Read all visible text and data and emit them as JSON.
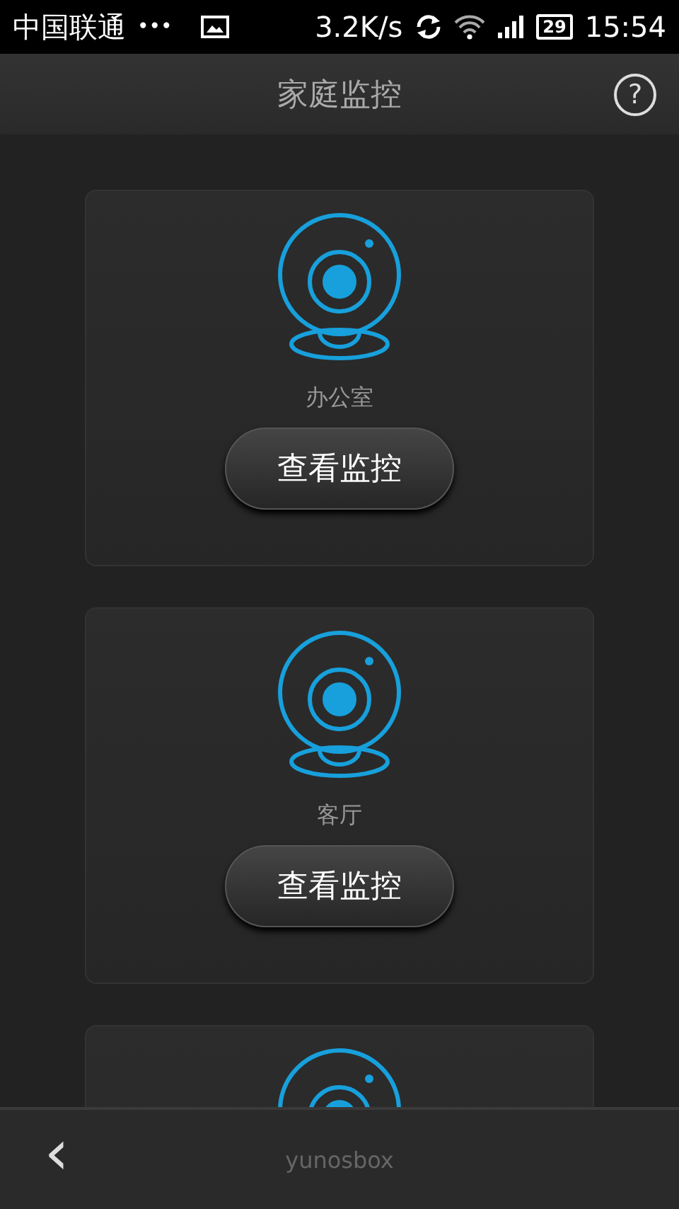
{
  "status_bar": {
    "carrier": "中国联通",
    "dots": "•••",
    "speed": "3.2K/s",
    "battery": "29",
    "time": "15:54"
  },
  "header": {
    "title": "家庭监控",
    "help": "?"
  },
  "cameras": [
    {
      "kind": "camera",
      "name": "办公室",
      "button": "查看监控"
    },
    {
      "kind": "camera",
      "name": "客厅",
      "button": "查看监控"
    },
    {
      "kind": "camera"
    }
  ],
  "bottom_bar": {
    "back": "‹",
    "device": "yunosbox"
  }
}
